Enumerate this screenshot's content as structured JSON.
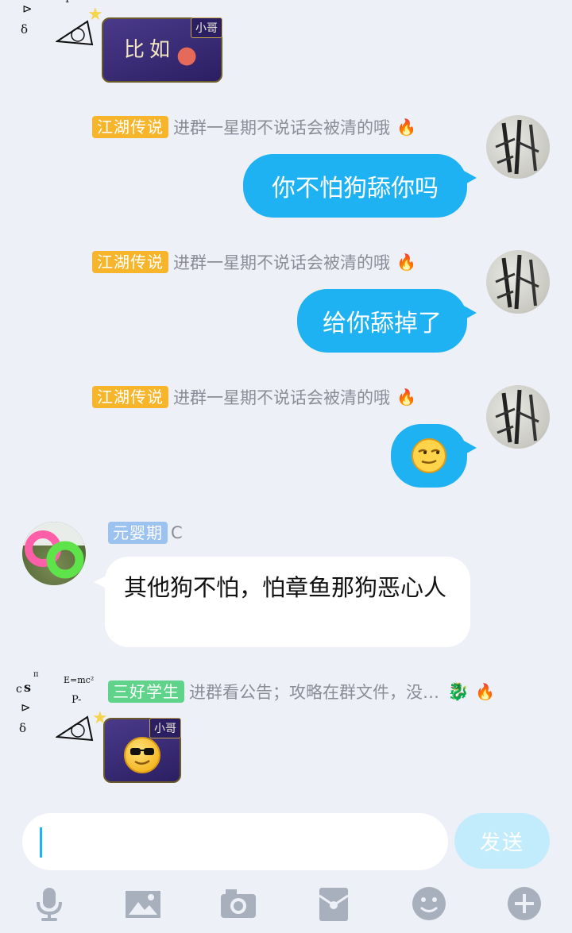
{
  "messages": [
    {
      "sender_badge": "江湖传说",
      "sender_name": "进群一星期不说话会被清的哦",
      "text": "你不怕狗舔你吗"
    },
    {
      "sender_badge": "江湖传说",
      "sender_name": "进群一星期不说话会被清的哦",
      "text": "给你舔掉了"
    },
    {
      "sender_badge": "江湖传说",
      "sender_name": "进群一星期不说话会被清的哦",
      "text": ""
    },
    {
      "sender_badge": "元婴期",
      "sender_name": "C",
      "text": "其他狗不怕，怕章鱼那狗恶心人"
    },
    {
      "sender_badge": "三好学生",
      "sender_name": "进群看公告；攻略在群文件，没…",
      "text": ""
    }
  ],
  "stickers": {
    "top_text": "比如",
    "tag": "小哥",
    "bottom_tag": "小哥"
  },
  "input": {
    "value": "",
    "placeholder": ""
  },
  "send_label": "发送",
  "toolbar_icons": [
    "microphone-icon",
    "image-icon",
    "camera-icon",
    "red-packet-icon",
    "emoji-icon",
    "plus-icon"
  ],
  "colors": {
    "bubble_blue": "#1eb2f3",
    "badge_orange": "#f6b52a",
    "badge_blue": "#9cc2ef",
    "badge_green": "#5fd38a",
    "send_disabled": "#c2ecfb",
    "background": "#eef0f8"
  }
}
